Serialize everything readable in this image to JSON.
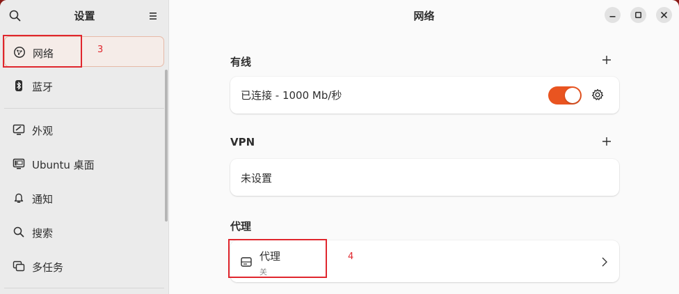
{
  "sidebar": {
    "title": "设置",
    "items": [
      {
        "label": "网络",
        "icon": "network-icon"
      },
      {
        "label": "蓝牙",
        "icon": "bluetooth-icon"
      },
      {
        "label": "外观",
        "icon": "appearance-icon"
      },
      {
        "label": "Ubuntu 桌面",
        "icon": "desktop-icon"
      },
      {
        "label": "通知",
        "icon": "bell-icon"
      },
      {
        "label": "搜索",
        "icon": "search-icon"
      },
      {
        "label": "多任务",
        "icon": "multitasking-icon"
      }
    ]
  },
  "main": {
    "title": "网络",
    "wired": {
      "label": "有线",
      "status": "已连接 - 1000 Mb/秒",
      "toggle_on": true
    },
    "vpn": {
      "label": "VPN",
      "status": "未设置"
    },
    "proxy": {
      "label": "代理",
      "row_title": "代理",
      "row_subtitle": "关"
    }
  },
  "annotations": {
    "first": "3",
    "second": "4"
  },
  "colors": {
    "accent": "#e95420",
    "annotation": "#e0262d"
  }
}
